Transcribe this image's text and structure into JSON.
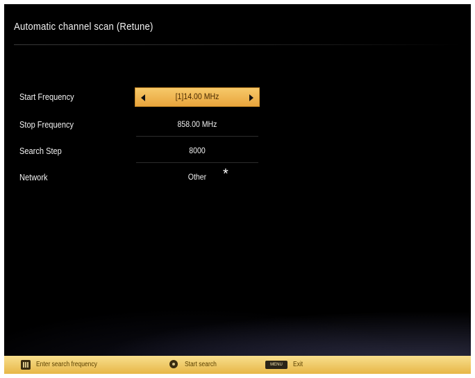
{
  "header": {
    "title": "Automatic channel scan (Retune)"
  },
  "settings": [
    {
      "label": "Start Frequency",
      "value": "[1]14.00 MHz",
      "selected": true
    },
    {
      "label": "Stop Frequency",
      "value": "858.00 MHz",
      "selected": false
    },
    {
      "label": "Search Step",
      "value": "8000",
      "selected": false
    },
    {
      "label": "Network",
      "value": "Other",
      "selected": false
    }
  ],
  "annotation": "*",
  "footer": {
    "hints": [
      {
        "icon": "numeric-keys-icon",
        "label": "Enter search frequency"
      },
      {
        "icon": "ok-button-icon",
        "label": "Start search"
      },
      {
        "icon": "menu-key-icon",
        "icon_text": "MENU",
        "label": "Exit"
      }
    ]
  },
  "colors": {
    "background": "#000000",
    "highlight": "#f1b957",
    "footer": "#efc862",
    "text": "#f0f0f0"
  }
}
